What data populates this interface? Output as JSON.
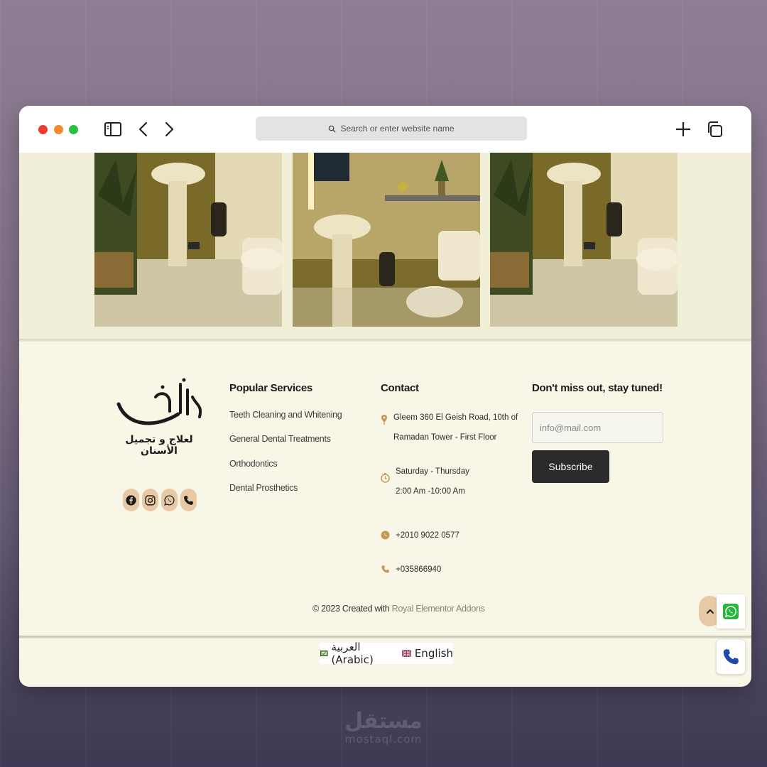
{
  "browser": {
    "address_placeholder": "Search or enter website name",
    "icons": [
      "sidebar-icon",
      "back-icon",
      "forward-icon",
      "search-icon",
      "new-tab-icon",
      "tabs-icon"
    ]
  },
  "brand": {
    "logo_name": "فن العرب",
    "logo_tagline": "لعلاج و تجميل الأسنان",
    "accent_color": "#e8c9a6",
    "icon_color": "#c39a55"
  },
  "social": [
    "facebook-icon",
    "instagram-icon",
    "whatsapp-icon",
    "phone-icon"
  ],
  "popular_services": {
    "title": "Popular Services",
    "items": [
      "Teeth Cleaning and Whitening",
      "General Dental Treatments",
      "Orthodontics",
      "Dental Prosthetics"
    ]
  },
  "contact": {
    "title": "Contact",
    "address_line1": "Gleem 360 El Geish Road, 10th of",
    "address_line2": "Ramadan Tower - First Floor",
    "hours_line1": "Saturday - Thursday",
    "hours_line2": "2:00 Am -10:00 Am",
    "whatsapp": "+2010 9022 0577",
    "phone": "+035866940"
  },
  "newsletter": {
    "title": "Don't miss out, stay tuned!",
    "email_placeholder": "info@mail.com",
    "button": "Subscribe"
  },
  "copyright": {
    "prefix": "© 2023 Created with ",
    "link": "Royal Elementor Addons"
  },
  "languages": [
    {
      "label": "العربية (Arabic)",
      "flag": "egypt-flag"
    },
    {
      "label": "English",
      "flag": "uk-flag"
    }
  ],
  "watermark": {
    "ar": "مستقل",
    "en": "mostaql.com"
  }
}
